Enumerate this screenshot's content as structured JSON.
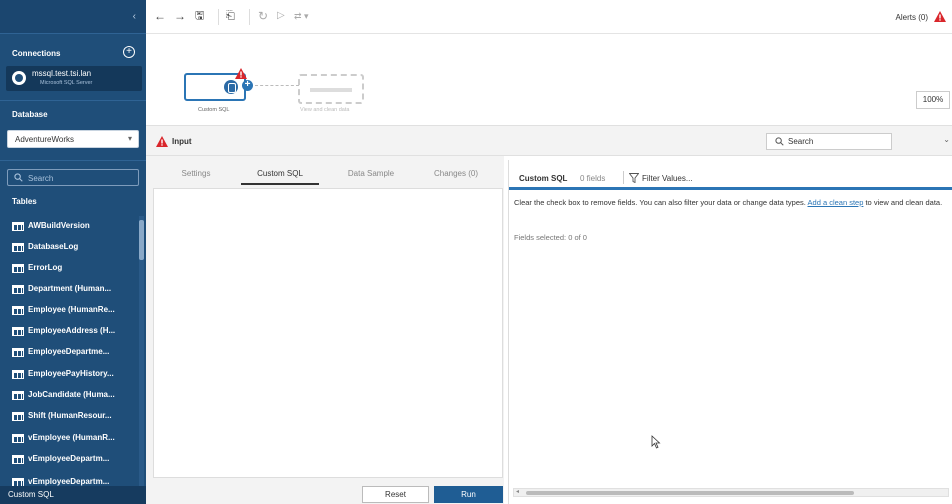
{
  "sidebar": {
    "connections_heading": "Connections",
    "connection": {
      "name": "mssql.test.tsi.lan",
      "type": "Microsoft SQL Server"
    },
    "database_heading": "Database",
    "database_value": "AdventureWorks",
    "search_placeholder": "Search",
    "tables_heading": "Tables",
    "tables": [
      "AWBuildVersion",
      "DatabaseLog",
      "ErrorLog",
      "Department (Human...",
      "Employee (HumanRe...",
      "EmployeeAddress (H...",
      "EmployeeDepartme...",
      "EmployeePayHistory...",
      "JobCandidate (Huma...",
      "Shift (HumanResour...",
      "vEmployee (HumanR...",
      "vEmployeeDepartm...",
      "vEmployeeDepartm..."
    ],
    "footer": "Custom SQL"
  },
  "toolbar": {
    "back": "←",
    "forward": "→",
    "save": "🖫",
    "paste": "⎗",
    "refresh": "↻",
    "run": "▷",
    "run_menu": "⇄ ▾",
    "alerts": "Alerts (0)"
  },
  "canvas": {
    "node_label": "Custom SQL",
    "ghost_label": "View and clean data",
    "zoom": "100%"
  },
  "input_bar": {
    "title": "Input",
    "search_placeholder": "Search",
    "chevron": "⌄"
  },
  "left_panel": {
    "tabs": [
      "Settings",
      "Custom SQL",
      "Data Sample",
      "Changes (0)"
    ],
    "reset_label": "Reset",
    "run_label": "Run"
  },
  "right_panel": {
    "title": "Custom SQL",
    "fields": "0 fields",
    "filter": "Filter Values...",
    "desc_prefix": "Clear the check box to remove fields. You can also filter your data or change data types. ",
    "desc_link": "Add a clean step",
    "desc_suffix": " to view and clean data.",
    "selected": "Fields selected: 0 of 0"
  },
  "colors": {
    "sidebar": "#1f4e79",
    "accent": "#2b75b5",
    "warning": "#d9262b",
    "run_button": "#1f5d94"
  }
}
